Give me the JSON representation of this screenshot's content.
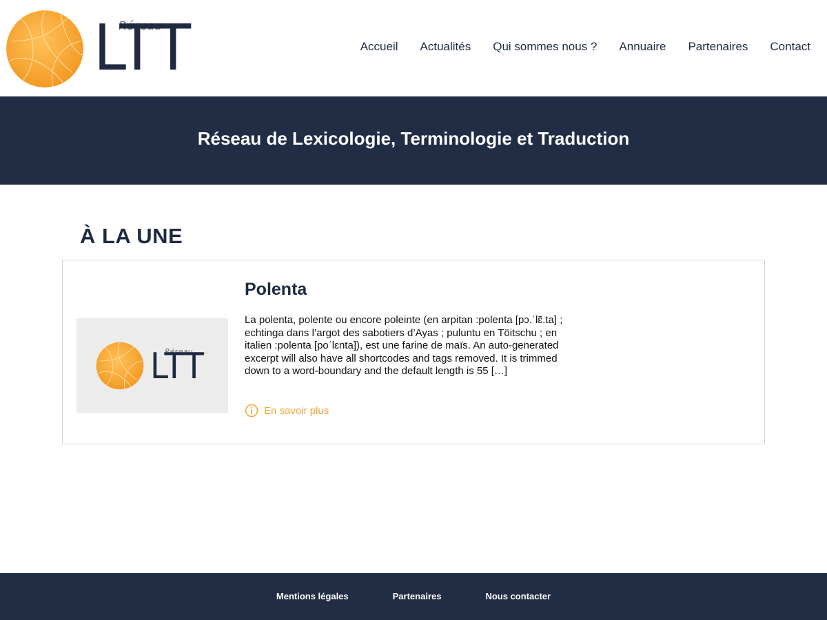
{
  "logo": {
    "small_text": "Réseau",
    "mark_text": "LTT",
    "icon": "orange-orb-logo-icon",
    "colors": {
      "orb": "#f5a33a",
      "mark": "#1f2a40"
    }
  },
  "nav": {
    "items": [
      {
        "label": "Accueil"
      },
      {
        "label": "Actualités"
      },
      {
        "label": "Qui sommes nous ?"
      },
      {
        "label": "Annuaire"
      },
      {
        "label": "Partenaires"
      },
      {
        "label": "Contact"
      }
    ]
  },
  "banner": {
    "title": "Réseau de Lexicologie, Terminologie et Traduction",
    "background": "#212d45"
  },
  "main": {
    "section_title": "À LA UNE",
    "post": {
      "thumbnail": {
        "small_text": "Réseau",
        "mark_text": "LTT"
      },
      "title": "Polenta",
      "excerpt": "La polenta, polente ou encore poleinte (en arpitan :polenta [pɔ.ˈlɛ̃.ta] ; echtinga dans l’argot des sabotiers d’Ayas ; puluntu en Töitschu ; en italien :polenta [poˈlɛnta]), est une farine de maïs. An auto-generated excerpt will also have all shortcodes and tags removed. It is trimmed down to a word-boundary and the default length is 55 […]",
      "read_more_label": "En savoir plus",
      "read_more_icon": "info-circle-icon",
      "accent_color": "#f5a33a"
    }
  },
  "footer": {
    "links": [
      {
        "label": "Mentions légales"
      },
      {
        "label": "Partenaires"
      },
      {
        "label": "Nous contacter"
      }
    ],
    "background": "#212d45"
  }
}
